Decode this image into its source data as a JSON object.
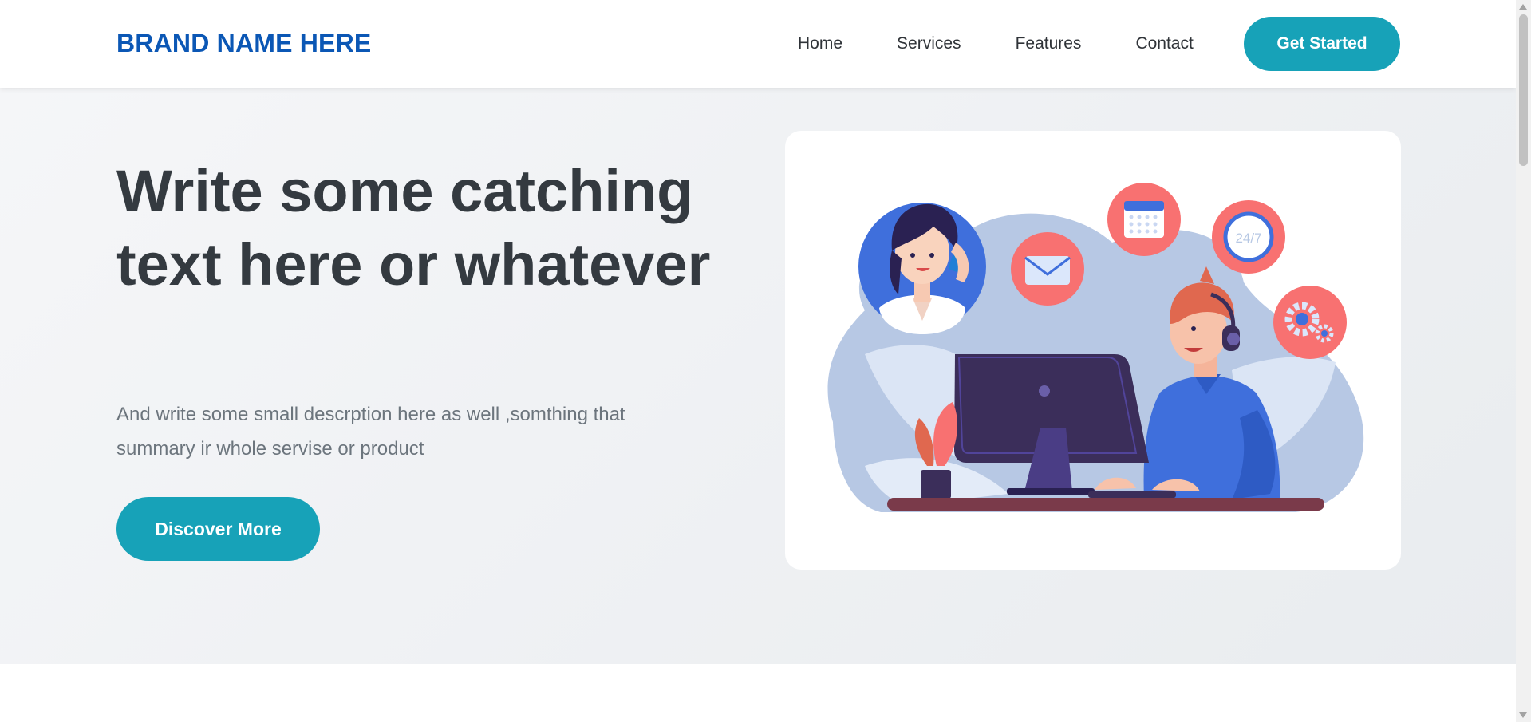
{
  "navbar": {
    "brand": "BRAND NAME HERE",
    "links": [
      "Home",
      "Services",
      "Features",
      "Contact"
    ],
    "cta_label": "Get Started"
  },
  "hero": {
    "title": "Write some catching text here or whatever",
    "description": "And write some small descrption here as well ,somthing that summary ir whole servise or product",
    "cta_label": "Discover More",
    "illustration_badge": "24/7"
  },
  "colors": {
    "brand": "#0b57b5",
    "accent": "#17a2b8",
    "heading": "#343a40",
    "muted": "#6c757d",
    "illustration_blob": "#b7c8e4",
    "illustration_coral": "#f87171",
    "illustration_purple": "#3b2e5a",
    "illustration_blue": "#3f6fdc"
  },
  "icons": [
    "phone-icon",
    "mail-icon",
    "calendar-icon",
    "clock-24-7-icon",
    "gears-icon",
    "headphones-icon",
    "monitor-icon",
    "plant-icon"
  ]
}
